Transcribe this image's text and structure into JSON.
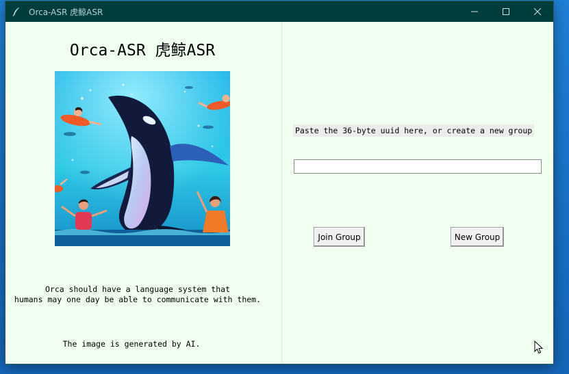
{
  "window": {
    "title": "Orca-ASR 虎鲸ASR",
    "controls": [
      "minimize-icon",
      "maximize-icon",
      "close-icon"
    ]
  },
  "left_panel": {
    "app_title": "Orca-ASR 虎鲸ASR",
    "hero_image": "orca whale with swimming people illustration",
    "description_line1": "Orca should have a language system that",
    "description_line2": "humans may one day be able to communicate with them.",
    "footnote": "The image is generated by AI."
  },
  "right_panel": {
    "prompt_label": "Paste the 36-byte uuid here, or create a new group",
    "uuid_input": {
      "value": "",
      "placeholder": ""
    },
    "join_button": "Join Group",
    "new_group_button": "New Group"
  },
  "colors": {
    "titlebar": "#003e3e",
    "window_bg": "#f0fff0",
    "label_bg": "#ececec"
  }
}
